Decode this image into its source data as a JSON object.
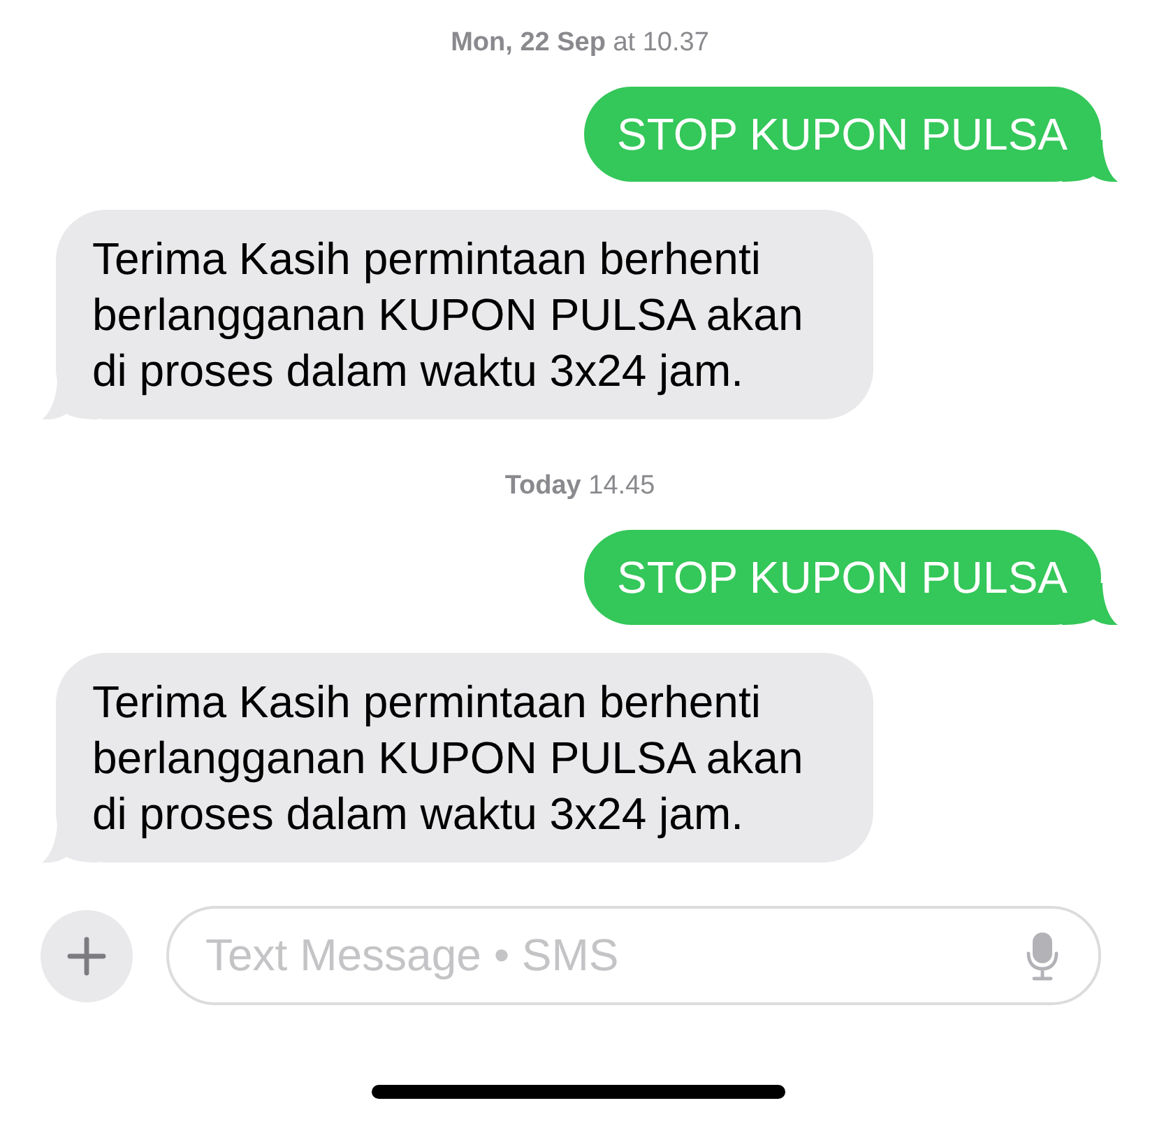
{
  "conversation": [
    {
      "kind": "timestamp",
      "text": "**Mon, 22 Sep** at 10.37"
    },
    {
      "kind": "sent",
      "text": "STOP KUPON PULSA"
    },
    {
      "kind": "received",
      "text": "Terima Kasih permintaan berhenti berlangganan KUPON PULSA akan di proses dalam waktu 3x24 jam."
    },
    {
      "kind": "timestamp",
      "text": "**Today** 14.45"
    },
    {
      "kind": "sent",
      "text": "STOP KUPON PULSA"
    },
    {
      "kind": "received",
      "text": "Terima Kasih permintaan berhenti berlangganan KUPON PULSA akan di proses dalam waktu 3x24 jam."
    }
  ],
  "composer": {
    "placeholder": "Text Message • SMS"
  }
}
